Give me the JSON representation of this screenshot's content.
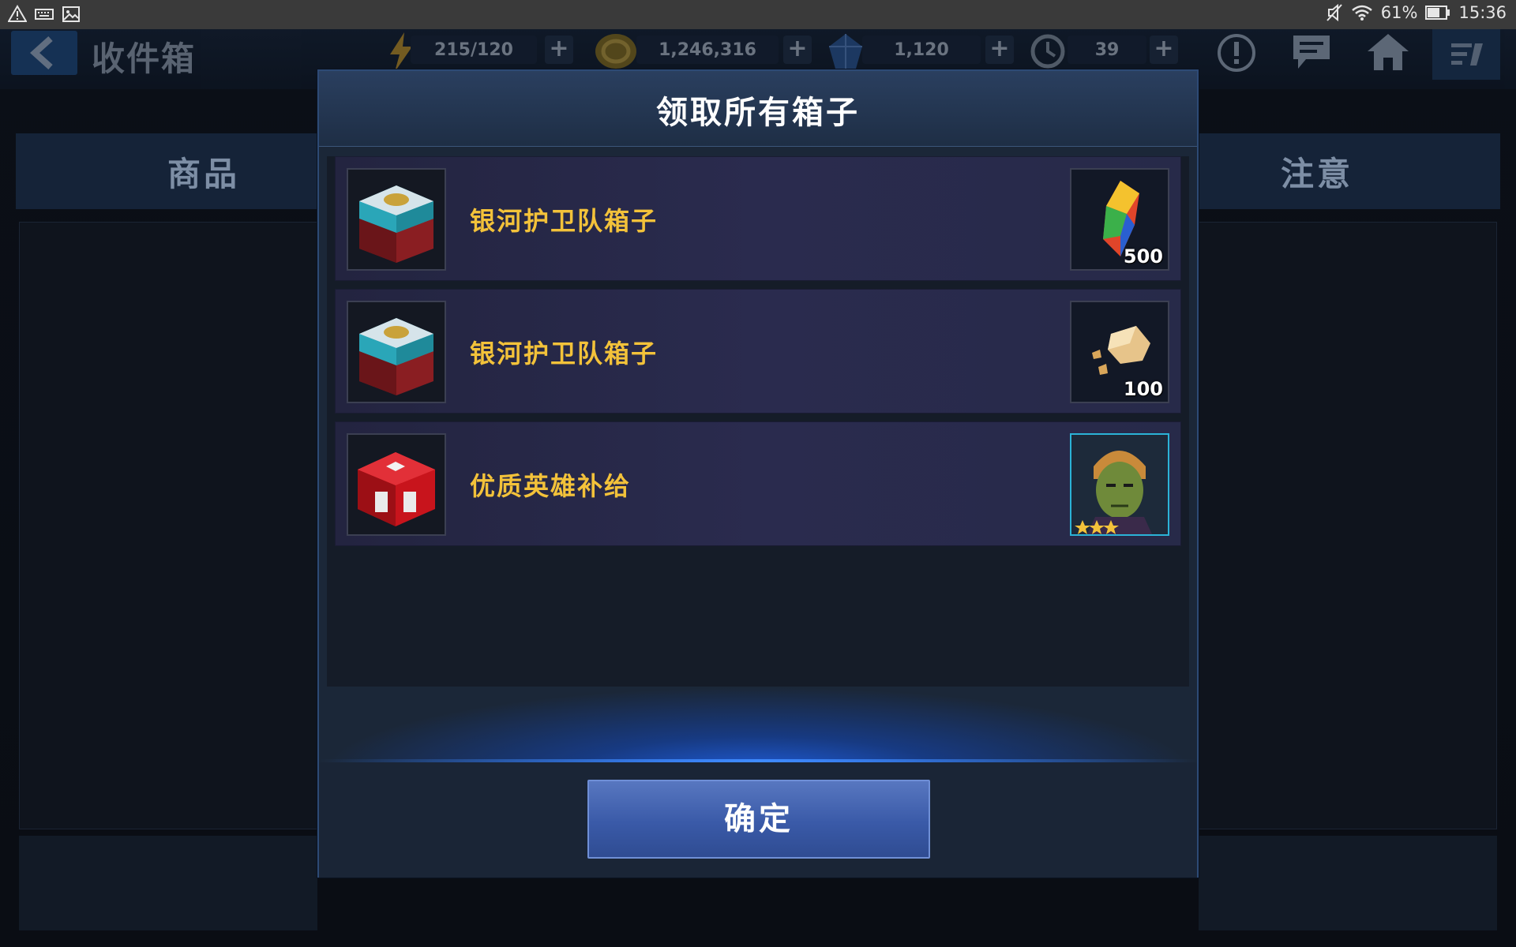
{
  "status_bar": {
    "battery": "61%",
    "time": "15:36",
    "icons": [
      "warning-icon",
      "keyboard-icon",
      "image-icon",
      "mute-icon",
      "wifi-icon",
      "battery-icon"
    ]
  },
  "game_header": {
    "title": "收件箱",
    "energy": "215/120",
    "gold": "1,246,316",
    "units": "1,120",
    "timer_count": "39",
    "icons": [
      "back-arrow-icon",
      "energy-icon",
      "gold-icon",
      "crystal-icon",
      "timer-icon",
      "alert-icon",
      "chat-icon",
      "home-icon",
      "menu-icon"
    ]
  },
  "background_table": {
    "col_items": "商品",
    "col_notice": "注意"
  },
  "modal": {
    "title": "领取所有箱子",
    "confirm_label": "确定",
    "rows": [
      {
        "name": "银河护卫队箱子",
        "reward_icon": "iso-8-shard-icon",
        "quantity": "500"
      },
      {
        "name": "银河护卫队箱子",
        "reward_icon": "gold-ore-icon",
        "quantity": "100"
      },
      {
        "name": "优质英雄补给",
        "reward_icon": "hero-portrait-icon",
        "stars": 3
      }
    ]
  },
  "colors": {
    "row_text": "#f3c23a",
    "accent_blue": "#3f8bff",
    "button": "#3a5aa8"
  }
}
